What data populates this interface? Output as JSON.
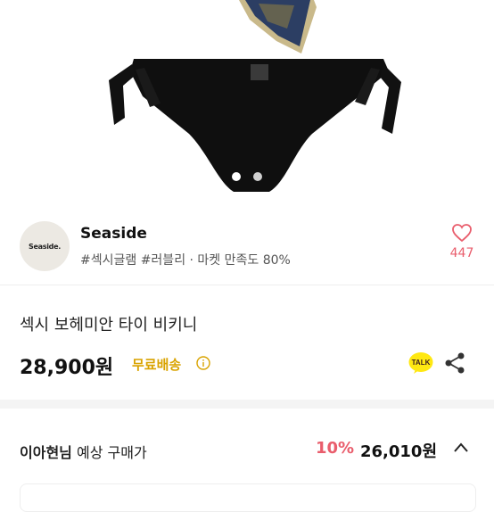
{
  "carousel": {
    "active_index": 0,
    "count": 2
  },
  "shop": {
    "logo_text": "Seaside.",
    "name": "Seaside",
    "meta": "#섹시글램 #러블리 · 마켓 만족도 80%",
    "likes": "447"
  },
  "product": {
    "title": "섹시 보헤미안 타이 비키니",
    "price": "28,900원",
    "shipping": "무료배송",
    "talk_label": "TALK"
  },
  "member": {
    "name": "이아현님",
    "label": "예상 구매가",
    "discount": "10%",
    "price": "26,010원"
  },
  "colors": {
    "accent_pink": "#e95d6c",
    "shipping_yellow": "#d9a300",
    "kakao_yellow": "#ffe812"
  }
}
